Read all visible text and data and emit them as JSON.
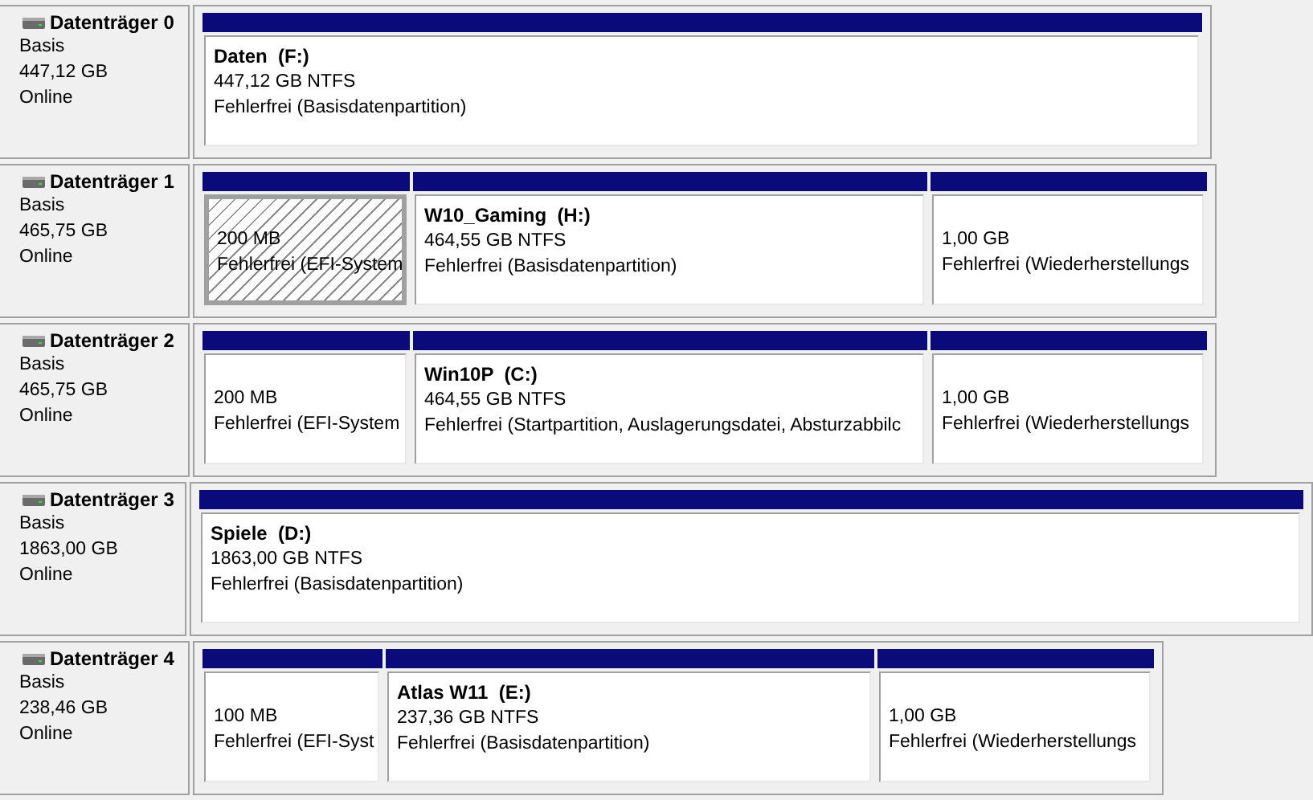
{
  "disks": [
    {
      "name": "Datenträger 0",
      "type": "Basis",
      "size": "447,12 GB",
      "status": "Online",
      "partitions": [
        {
          "label": "Daten  (F:)",
          "size": "447,12 GB NTFS",
          "state": "Fehlerfrei (Basisdatenpartition)",
          "selected": false
        }
      ]
    },
    {
      "name": "Datenträger 1",
      "type": "Basis",
      "size": "465,75 GB",
      "status": "Online",
      "partitions": [
        {
          "size": "200 MB",
          "state": "Fehlerfrei (EFI-System",
          "selected": true
        },
        {
          "label": "W10_Gaming  (H:)",
          "size": "464,55 GB NTFS",
          "state": "Fehlerfrei (Basisdatenpartition)",
          "selected": false
        },
        {
          "size": "1,00 GB",
          "state": "Fehlerfrei (Wiederherstellungs",
          "selected": false
        }
      ]
    },
    {
      "name": "Datenträger 2",
      "type": "Basis",
      "size": "465,75 GB",
      "status": "Online",
      "partitions": [
        {
          "size": "200 MB",
          "state": "Fehlerfrei (EFI-System",
          "selected": false
        },
        {
          "label": "Win10P  (C:)",
          "size": "464,55 GB NTFS",
          "state": "Fehlerfrei (Startpartition, Auslagerungsdatei, Absturzabbilc",
          "selected": false
        },
        {
          "size": "1,00 GB",
          "state": "Fehlerfrei (Wiederherstellungs",
          "selected": false
        }
      ]
    },
    {
      "name": "Datenträger 3",
      "type": "Basis",
      "size": "1863,00 GB",
      "status": "Online",
      "partitions": [
        {
          "label": "Spiele  (D:)",
          "size": "1863,00 GB NTFS",
          "state": "Fehlerfrei (Basisdatenpartition)",
          "selected": false
        }
      ]
    },
    {
      "name": "Datenträger 4",
      "type": "Basis",
      "size": "238,46 GB",
      "status": "Online",
      "partitions": [
        {
          "size": "100 MB",
          "state": "Fehlerfrei (EFI-Syst",
          "selected": false
        },
        {
          "label": "Atlas W11  (E:)",
          "size": "237,36 GB NTFS",
          "state": "Fehlerfrei (Basisdatenpartition)",
          "selected": false
        },
        {
          "size": "1,00 GB",
          "state": "Fehlerfrei (Wiederherstellungs",
          "selected": false
        }
      ]
    }
  ]
}
